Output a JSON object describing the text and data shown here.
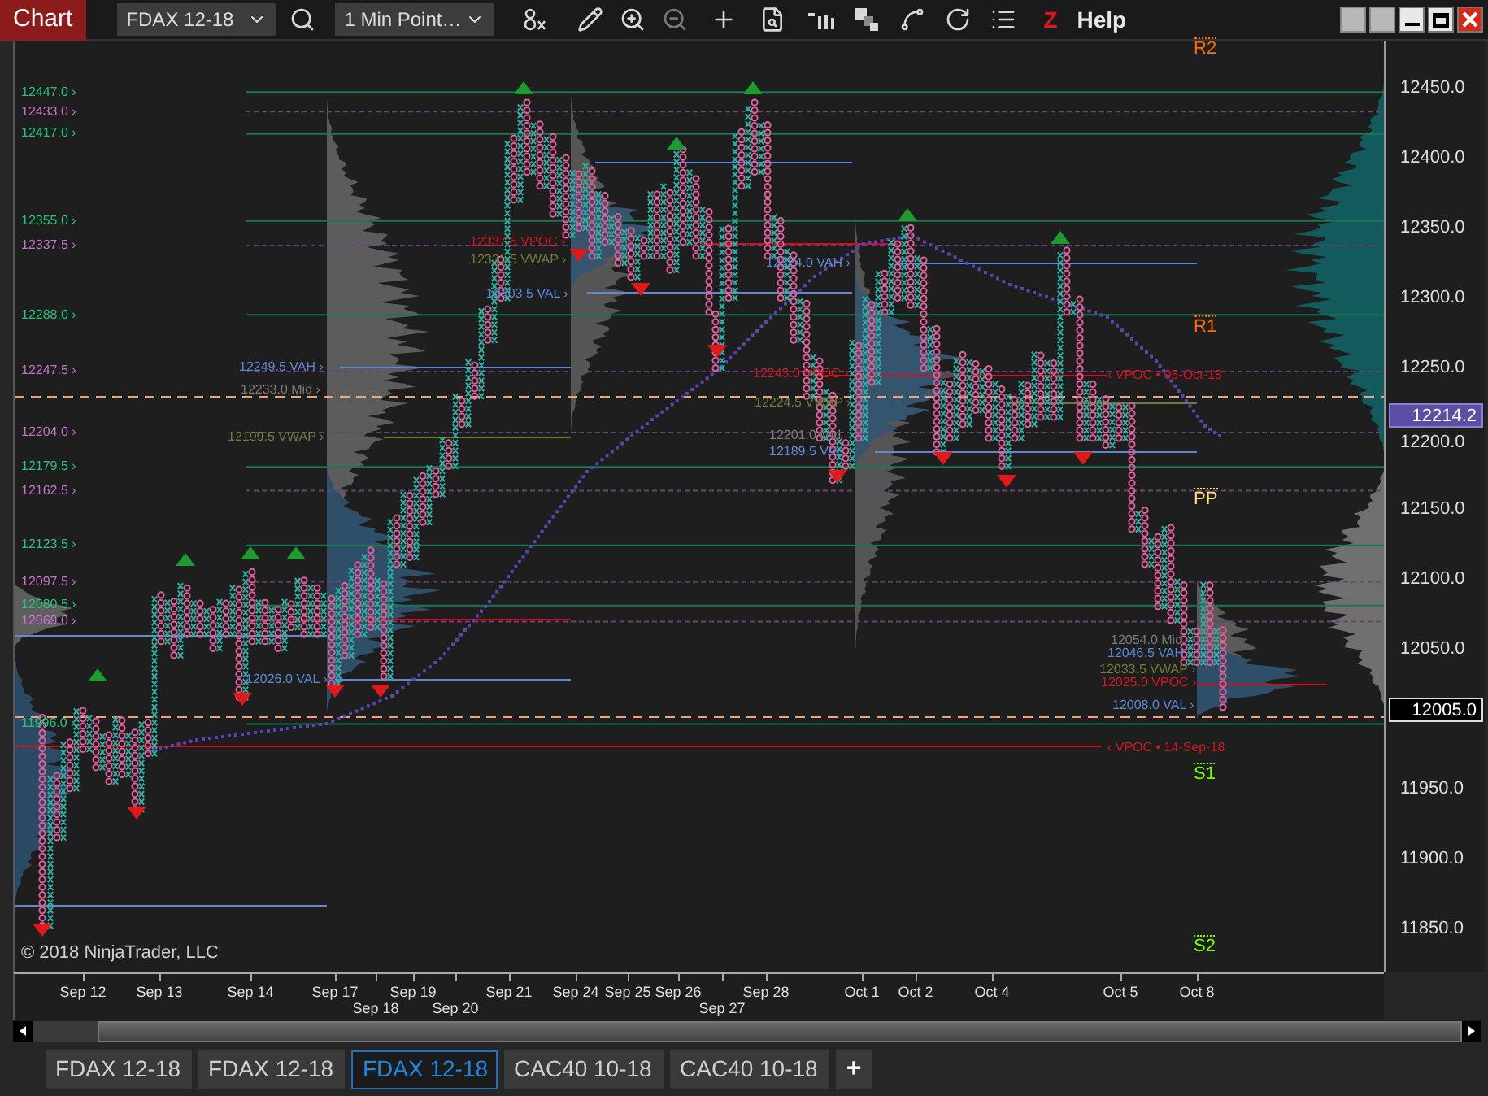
{
  "toolbar": {
    "title": "Chart",
    "instrument": "FDAX 12-18",
    "interval": "1 Min Point…",
    "z_label": "Z",
    "help": "Help"
  },
  "chart": {
    "level_labels": [
      {
        "text": "12447.0 ›",
        "kind": "solid"
      },
      {
        "text": "12433.0 ›",
        "kind": "dashed"
      },
      {
        "text": "12417.0 ›",
        "kind": "solid"
      },
      {
        "text": "12355.0 ›",
        "kind": "solid"
      },
      {
        "text": "12337.5 ›",
        "kind": "dashed"
      },
      {
        "text": "12288.0 ›",
        "kind": "solid"
      },
      {
        "text": "12247.5 ›",
        "kind": "dashed"
      },
      {
        "text": "12204.0 ›",
        "kind": "dashed"
      },
      {
        "text": "12179.5 ›",
        "kind": "solid"
      },
      {
        "text": "12162.5 ›",
        "kind": "dashed"
      },
      {
        "text": "12123.5 ›",
        "kind": "solid"
      },
      {
        "text": "12097.5 ›",
        "kind": "dashed"
      },
      {
        "text": "12080.5 ›",
        "kind": "solid"
      },
      {
        "text": "12069.0 ›",
        "kind": "dashed"
      },
      {
        "text": "11996.0 ›",
        "kind": "solid"
      }
    ],
    "annotations": [
      {
        "text": "12249.5 VAH ›",
        "kind": "vah"
      },
      {
        "text": "12233.0 Mid ›",
        "kind": "mid"
      },
      {
        "text": "12199.5 VWAP ›",
        "kind": "vwap"
      },
      {
        "text": "12026.0 VAL ›",
        "kind": "val"
      },
      {
        "text": "12337.5 VPOC ›",
        "kind": "vpoc"
      },
      {
        "text": "12331.5 VWAP ›",
        "kind": "vwap"
      },
      {
        "text": "12303.5 VAL ›",
        "kind": "val"
      },
      {
        "text": "12324.0 VAH ›",
        "kind": "vah"
      },
      {
        "text": "12243.0 VPOC ›",
        "kind": "vpoc"
      },
      {
        "text": "12224.5 VWAP ›",
        "kind": "vwap"
      },
      {
        "text": "12201.0 Mid",
        "kind": "mid"
      },
      {
        "text": "12189.5 VAL",
        "kind": "val"
      },
      {
        "text": "‹ VPOC • 05-Oct-18",
        "kind": "vpoc"
      },
      {
        "text": "12054.0 Mid",
        "kind": "mid"
      },
      {
        "text": "12046.5 VAH ›",
        "kind": "vah"
      },
      {
        "text": "12033.5 VWAP ›",
        "kind": "vwap"
      },
      {
        "text": "12025.0 VPOC ›",
        "kind": "vpoc"
      },
      {
        "text": "12008.0 VAL ›",
        "kind": "val"
      },
      {
        "text": "‹ VPOC • 14-Sep-18",
        "kind": "vpoc"
      }
    ],
    "pivots": [
      {
        "text": "R2",
        "kind": "resistance"
      },
      {
        "text": "R1",
        "kind": "resistance"
      },
      {
        "text": "PP",
        "kind": "pivot"
      },
      {
        "text": "S1",
        "kind": "support"
      },
      {
        "text": "S2",
        "kind": "support"
      }
    ],
    "price_axis": [
      "12450.0",
      "12400.0",
      "12350.0",
      "12300.0",
      "12250.0",
      "12200.0",
      "12150.0",
      "12100.0",
      "12050.0",
      "11950.0",
      "11900.0",
      "11850.0"
    ],
    "price_markers": [
      {
        "text": "12214.2",
        "kind": "last"
      },
      {
        "text": "12005.0",
        "kind": "current"
      }
    ],
    "date_axis": [
      "Sep 12",
      "Sep 13",
      "Sep 14",
      "Sep 17",
      "Sep 18",
      "Sep 19",
      "Sep 20",
      "Sep 21",
      "Sep 24",
      "Sep 25",
      "Sep 26",
      "Sep 27",
      "Sep 28",
      "Oct 1",
      "Oct 2",
      "Oct 4",
      "Oct 5",
      "Oct 8"
    ],
    "copyright": "© 2018 NinjaTrader, LLC"
  },
  "tabs": [
    {
      "label": "FDAX 12-18",
      "selected": false
    },
    {
      "label": "FDAX 12-18",
      "selected": false
    },
    {
      "label": "FDAX 12-18",
      "selected": true
    },
    {
      "label": "CAC40 10-18",
      "selected": false
    },
    {
      "label": "CAC40 10-18",
      "selected": false
    }
  ],
  "add_tab": "+"
}
